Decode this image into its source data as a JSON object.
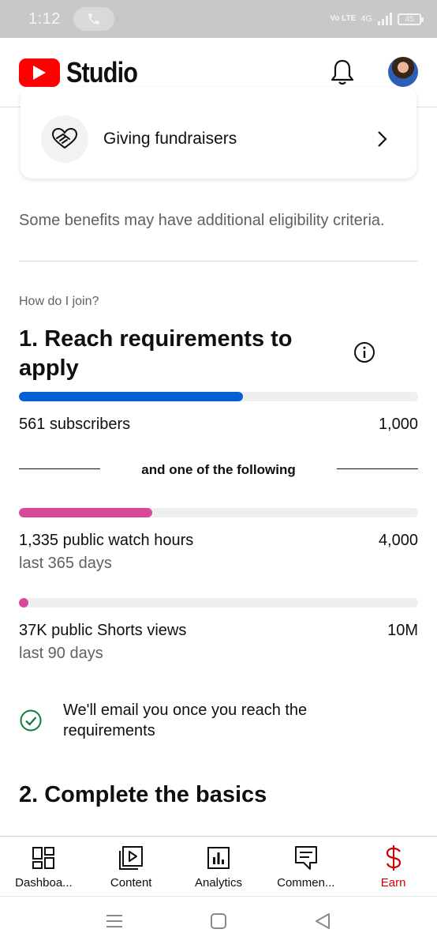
{
  "status_bar": {
    "time": "1:12",
    "network": "4G",
    "volte": "Vo LTE",
    "battery": "45"
  },
  "header": {
    "app_name": "Studio",
    "icons": [
      "youtube-logo-icon",
      "notification-bell-icon",
      "account-avatar"
    ]
  },
  "card": {
    "label": "Giving fundraisers",
    "icon": "handshake-heart-icon"
  },
  "benefit_note": "Some benefits may have additional eligibility criteria.",
  "join": {
    "label": "How do I join?",
    "title": "1. Reach requirements to apply",
    "subscribers": {
      "label": "561 subscribers",
      "goal": "1,000",
      "progress": 0.561,
      "color": "#065fd4"
    },
    "separator": "and one of the following",
    "watch_hours": {
      "label": "1,335 public watch hours",
      "goal": "4,000",
      "period": "last 365 days",
      "progress": 0.334,
      "color": "#d9499a"
    },
    "shorts_views": {
      "label": "37K public Shorts views",
      "goal": "10M",
      "period": "last 90 days",
      "progress": 0.0037,
      "color": "#d9499a"
    },
    "email_note": "We'll email you once you reach the requirements"
  },
  "basics": {
    "title": "2. Complete the basics"
  },
  "bottom_nav": {
    "items": [
      {
        "label": "Dashboa...",
        "icon": "dashboard-icon"
      },
      {
        "label": "Content",
        "icon": "content-icon"
      },
      {
        "label": "Analytics",
        "icon": "analytics-icon"
      },
      {
        "label": "Commen...",
        "icon": "comments-icon"
      },
      {
        "label": "Earn",
        "icon": "earn-icon",
        "active": true
      }
    ],
    "active_color": "#cc0000"
  },
  "system_nav": [
    "menu-icon",
    "home-icon",
    "back-icon"
  ]
}
